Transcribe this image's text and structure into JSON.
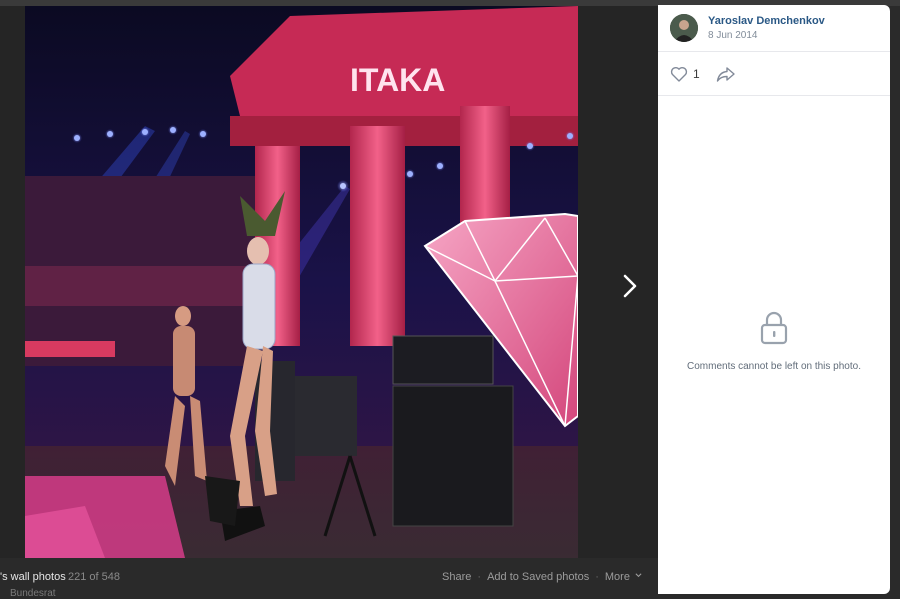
{
  "viewer": {
    "album_label": "'s wall photos",
    "counter": "221 of 548",
    "actions": {
      "share": "Share",
      "save": "Add to Saved photos",
      "more": "More"
    },
    "under_text": "Bundesrat"
  },
  "photo": {
    "sign_text": "ITAKA"
  },
  "sidebar": {
    "author_name": "Yaroslav Demchenkov",
    "date": "8 Jun 2014",
    "likes_count": "1",
    "comments_closed": "Comments cannot be left on this photo."
  },
  "icons": {
    "next": "chevron-right-icon",
    "like": "heart-icon",
    "share": "share-arrow-icon",
    "lock": "lock-icon",
    "more": "chevron-down-icon"
  },
  "colors": {
    "link": "#2a5885",
    "muted": "#818c99",
    "stage_pink": "#e0386e",
    "stage_blue": "#3a4bd6"
  }
}
